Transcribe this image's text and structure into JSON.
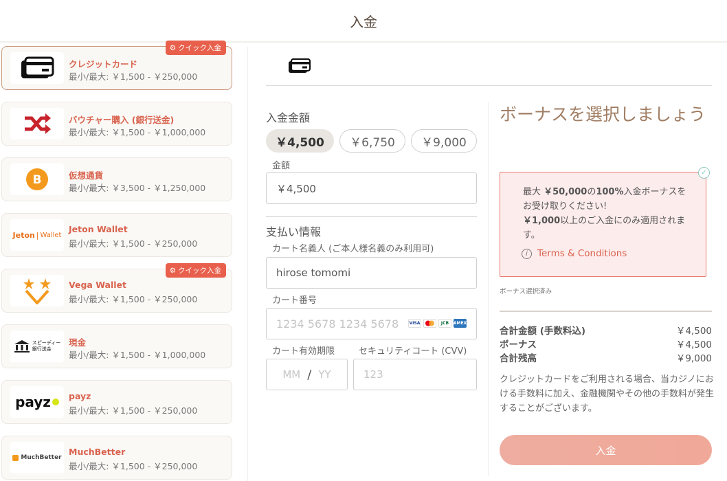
{
  "header": {
    "title": "入金"
  },
  "methods": [
    {
      "name": "クレジットカード",
      "limits": "最小/最大: ￥1,500 - ￥250,000",
      "quick": "クイック入金",
      "icon": "credit-card-icon"
    },
    {
      "name": "バウチャー購入 (銀行送金)",
      "limits": "最小/最大: ￥1,500 - ￥1,000,000",
      "icon": "shuffle-icon"
    },
    {
      "name": "仮想通貨",
      "limits": "最小/最大: ￥3,500 - ￥1,250,000",
      "icon": "bitcoin-icon"
    },
    {
      "name": "Jeton Wallet",
      "limits": "最小/最大: ￥1,500 - ￥250,000",
      "logo_text": "Jeton",
      "logo_text2": "Wallet"
    },
    {
      "name": "Vega Wallet",
      "limits": "最小/最大: ￥1,500 - ￥250,000",
      "quick": "クイック入金",
      "icon": "vega-stars-icon"
    },
    {
      "name": "現金",
      "limits": "最小/最大: ￥1,500 - ￥1,000,000",
      "logo_text": "スピーディー",
      "logo_text2": "銀行送金"
    },
    {
      "name": "payz",
      "limits": "最小/最大: ￥1,500 - ￥250,000",
      "logo_text": "payz"
    },
    {
      "name": "MuchBetter",
      "limits": "最小/最大: ￥1,500 - ￥250,000",
      "logo_text": "MuchBetter"
    }
  ],
  "form": {
    "amount_title": "入金金額",
    "amount_options": [
      "￥4,500",
      "￥6,750",
      "￥9,000"
    ],
    "amount_label": "金額",
    "amount_value": "￥4,500",
    "payment_title": "支払い情報",
    "holder_label": "カート名義人 (ご本人様名義のみ利用可)",
    "holder_value": "hirose tomomi",
    "number_label": "カート番号",
    "number_placeholder": "1234 5678 1234 5678",
    "card_brands": [
      "VISA",
      "MC",
      "JCB",
      "AMEX"
    ],
    "expiry_label": "カート有効期限",
    "expiry_mm": "MM",
    "expiry_sep": "/",
    "expiry_yy": "YY",
    "cvv_label": "セキュリティコート (CVV)",
    "cvv_placeholder": "123"
  },
  "bonus": {
    "title": "ボーナスを選択しましょう",
    "line1_pre": "最大 ",
    "line1_amount": "￥50,000",
    "line1_mid": "の",
    "line1_pct": "100%",
    "line1_post": "入金ボーナスをお受け取りください!",
    "line2_amount": "￥1,000",
    "line2_post": "以上のご入金にのみ適用されます。",
    "terms": "Terms & Conditions",
    "selected_note": "ボーナス選択済み"
  },
  "summary": {
    "rows": [
      {
        "label": "合計金額 (手数料込)",
        "value": "￥4,500"
      },
      {
        "label": "ボーナス",
        "value": "￥4,500"
      },
      {
        "label": "合計残高",
        "value": "￥9,000"
      }
    ],
    "note": "クレジットカードをご利用される場合、当カジノにおける手数料に加え、金融機関やその他の手数料が発生することがございます。",
    "submit": "入金"
  },
  "colors": {
    "accent": "#d9634e",
    "quick_badge": "#e8604c",
    "bonus_bg": "#fdecec",
    "bonus_border": "#e97c6b",
    "submit": "#f0a898"
  }
}
